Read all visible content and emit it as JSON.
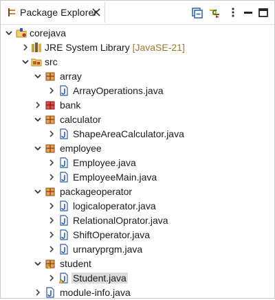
{
  "view": {
    "title": "Package Explorer",
    "toolbar": [
      "collapse-all-icon",
      "link-with-editor-icon",
      "view-menu-icon",
      "minimize-icon",
      "maximize-icon"
    ]
  },
  "tree": {
    "project": {
      "label": "corejava"
    },
    "jre": {
      "label": "JRE System Library",
      "decoration": "[JavaSE-21]"
    },
    "src": {
      "label": "src"
    },
    "pkg_array": {
      "label": "array"
    },
    "file_arrayops": {
      "label": "ArrayOperations.java"
    },
    "pkg_bank": {
      "label": "bank"
    },
    "pkg_calculator": {
      "label": "calculator"
    },
    "file_shapearea": {
      "label": "ShapeAreaCalculator.java"
    },
    "pkg_employee": {
      "label": "employee"
    },
    "file_employee": {
      "label": "Employee.java"
    },
    "file_employeemain": {
      "label": "EmployeeMain.java"
    },
    "pkg_packageoperator": {
      "label": "packageoperator"
    },
    "file_logical": {
      "label": "logicaloperator.java"
    },
    "file_relational": {
      "label": "RelationalOprator.java"
    },
    "file_shift": {
      "label": "ShiftOperator.java"
    },
    "file_urnary": {
      "label": "urnaryprgm.java"
    },
    "pkg_student": {
      "label": "student"
    },
    "file_student": {
      "label": "Student.java"
    },
    "file_moduleinfo": {
      "label": "module-info.java"
    }
  },
  "colors": {
    "package_brown": "#b5651d",
    "package_red": "#c0392b",
    "java_blue": "#2a5ca8",
    "jre_decoration": "#9a7a2a",
    "selection": "#dcdcdc"
  }
}
